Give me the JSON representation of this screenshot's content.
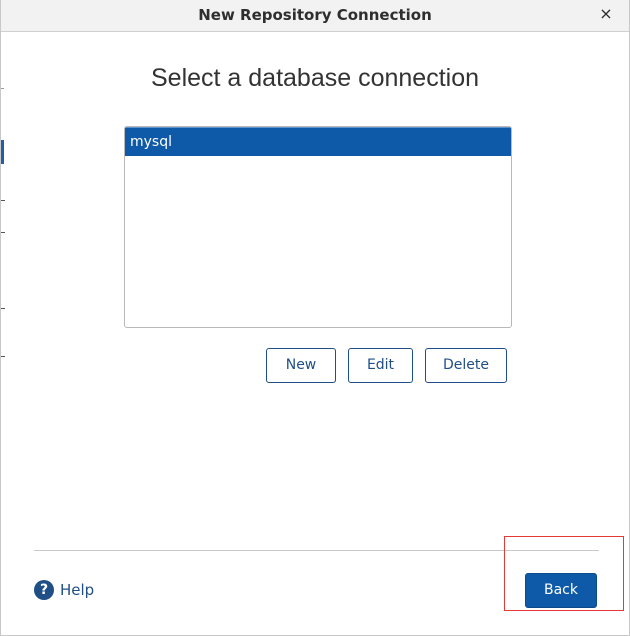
{
  "window": {
    "title": "New Repository Connection",
    "close_glyph": "×"
  },
  "main": {
    "heading": "Select a database connection",
    "connections": [
      {
        "label": "mysql",
        "selected": true
      }
    ],
    "buttons": {
      "new_label": "New",
      "edit_label": "Edit",
      "delete_label": "Delete"
    }
  },
  "footer": {
    "help_glyph": "?",
    "help_label": "Help",
    "back_label": "Back"
  },
  "colors": {
    "accent": "#0f5aa8",
    "outline": "#1f4f86",
    "annotation": "#e53935"
  }
}
